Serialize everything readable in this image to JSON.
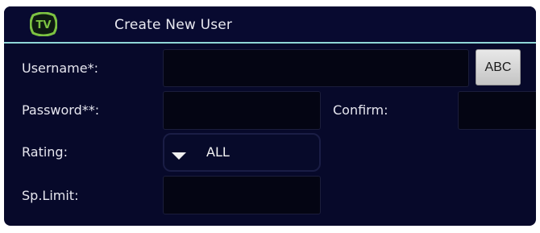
{
  "header": {
    "logo_text": "TV",
    "title": "Create New User"
  },
  "form": {
    "username": {
      "label": "Username*:",
      "value": ""
    },
    "keyboard_button_label": "ABC",
    "password": {
      "label": "Password**:",
      "value": ""
    },
    "confirm": {
      "label": "Confirm:",
      "value": ""
    },
    "rating": {
      "label": "Rating:",
      "value": "ALL",
      "icon": "dropdown-arrow-icon"
    },
    "spending_limit": {
      "label": "Sp.Limit:",
      "value": ""
    }
  },
  "colors": {
    "panel_background": "#07092a",
    "header_separator": "#8fd6d6",
    "logo_green": "#7cc242",
    "field_background": "#040513"
  }
}
